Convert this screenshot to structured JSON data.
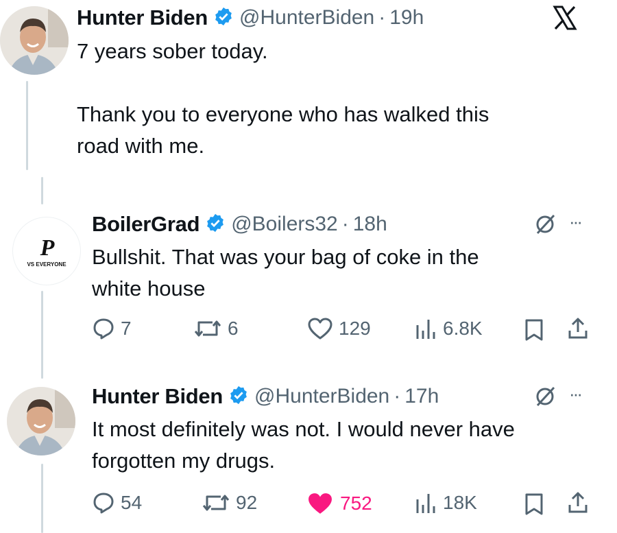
{
  "tweet1": {
    "name": "Hunter Biden",
    "handle": "@HunterBiden",
    "time": "19h",
    "text_line1": "7 years sober today.",
    "text_line2": "Thank you to everyone who has walked this",
    "text_line3": "road with me.",
    "avatar_icon": "person-photo-avatar"
  },
  "reply1": {
    "name": "BoilerGrad",
    "handle": "@Boilers32",
    "time": "18h",
    "text_line1": "Bullshit. That was your bag of coke in the",
    "text_line2": "white house",
    "avatar_logo_letter": "P",
    "avatar_logo_text": "VS EVERYONE",
    "replies": "7",
    "reposts": "6",
    "likes": "129",
    "views": "6.8K"
  },
  "reply2": {
    "name": "Hunter Biden",
    "handle": "@HunterBiden",
    "time": "17h",
    "text_line1": "It most definitely was not. I would never have",
    "text_line2": "forgotten my drugs.",
    "replies": "54",
    "reposts": "92",
    "likes": "752",
    "views": "18K",
    "like_color": "#f91880"
  },
  "separator": "·",
  "more_menu": "···",
  "colors": {
    "verified": "#1d9bf0",
    "muted": "#536471",
    "line": "#cfd9de"
  }
}
